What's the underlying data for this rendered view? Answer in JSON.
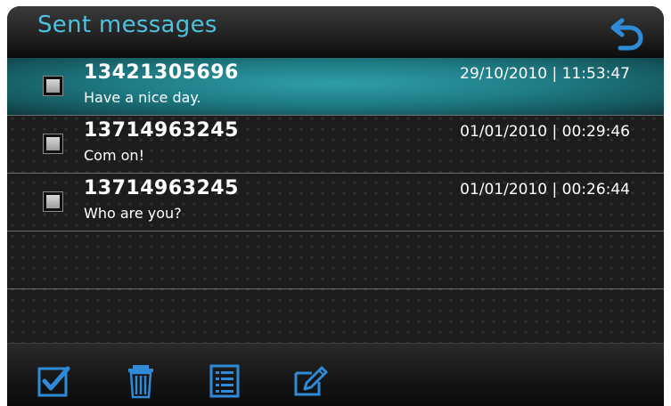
{
  "header": {
    "title": "Sent messages",
    "back_icon": "back-arrow-icon"
  },
  "messages": [
    {
      "number": "13421305696",
      "text": "Have a nice day.",
      "timestamp": "29/10/2010 | 11:53:47",
      "selected": true
    },
    {
      "number": "13714963245",
      "text": "Com on!",
      "timestamp": "01/01/2010 | 00:29:46",
      "selected": false
    },
    {
      "number": "13714963245",
      "text": "Who are you?",
      "timestamp": "01/01/2010 | 00:26:44",
      "selected": false
    }
  ],
  "toolbar": {
    "icons": [
      "select-all-icon",
      "trash-icon",
      "list-icon",
      "edit-icon"
    ]
  },
  "colors": {
    "accent": "#4ec1de",
    "selected_row": "#1f7d86",
    "icon_blue": "#2f8ad8"
  }
}
